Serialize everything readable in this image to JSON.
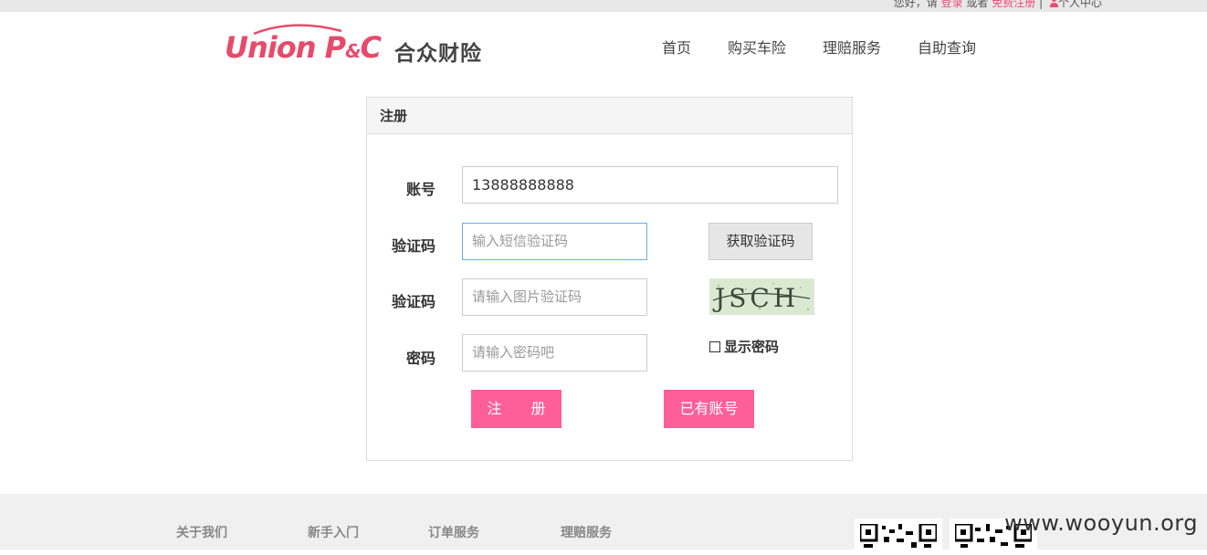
{
  "topbar": {
    "greeting": "您好，请",
    "login": "登录",
    "or": "或者",
    "register_free": "免费注册",
    "separator": "|",
    "personal_center": "个人中心"
  },
  "brand": {
    "logo_en_union": "Union",
    "logo_en_p": "P",
    "logo_en_amp": "&",
    "logo_en_c": "C",
    "logo_cn": "合众财险",
    "color": "#e84a6a"
  },
  "nav": {
    "items": [
      "首页",
      "购买车险",
      "理赔服务",
      "自助查询"
    ]
  },
  "form": {
    "title": "注册",
    "account_label": "账号",
    "account_value": "13888888888",
    "sms_label": "验证码",
    "sms_placeholder": "输入短信验证码",
    "get_code_button": "获取验证码",
    "image_code_label": "验证码",
    "image_code_placeholder": "请输入图片验证码",
    "captcha_text": "JSCH",
    "password_label": "密码",
    "password_placeholder": "请输入密码吧",
    "show_password": "显示密码",
    "register_button": "注　　册",
    "have_account_button": "已有账号",
    "accent_color": "#ff5f99"
  },
  "footer": {
    "links": [
      "关于我们",
      "新手入门",
      "订单服务",
      "理赔服务"
    ],
    "watermark": "www.wooyun.org"
  }
}
